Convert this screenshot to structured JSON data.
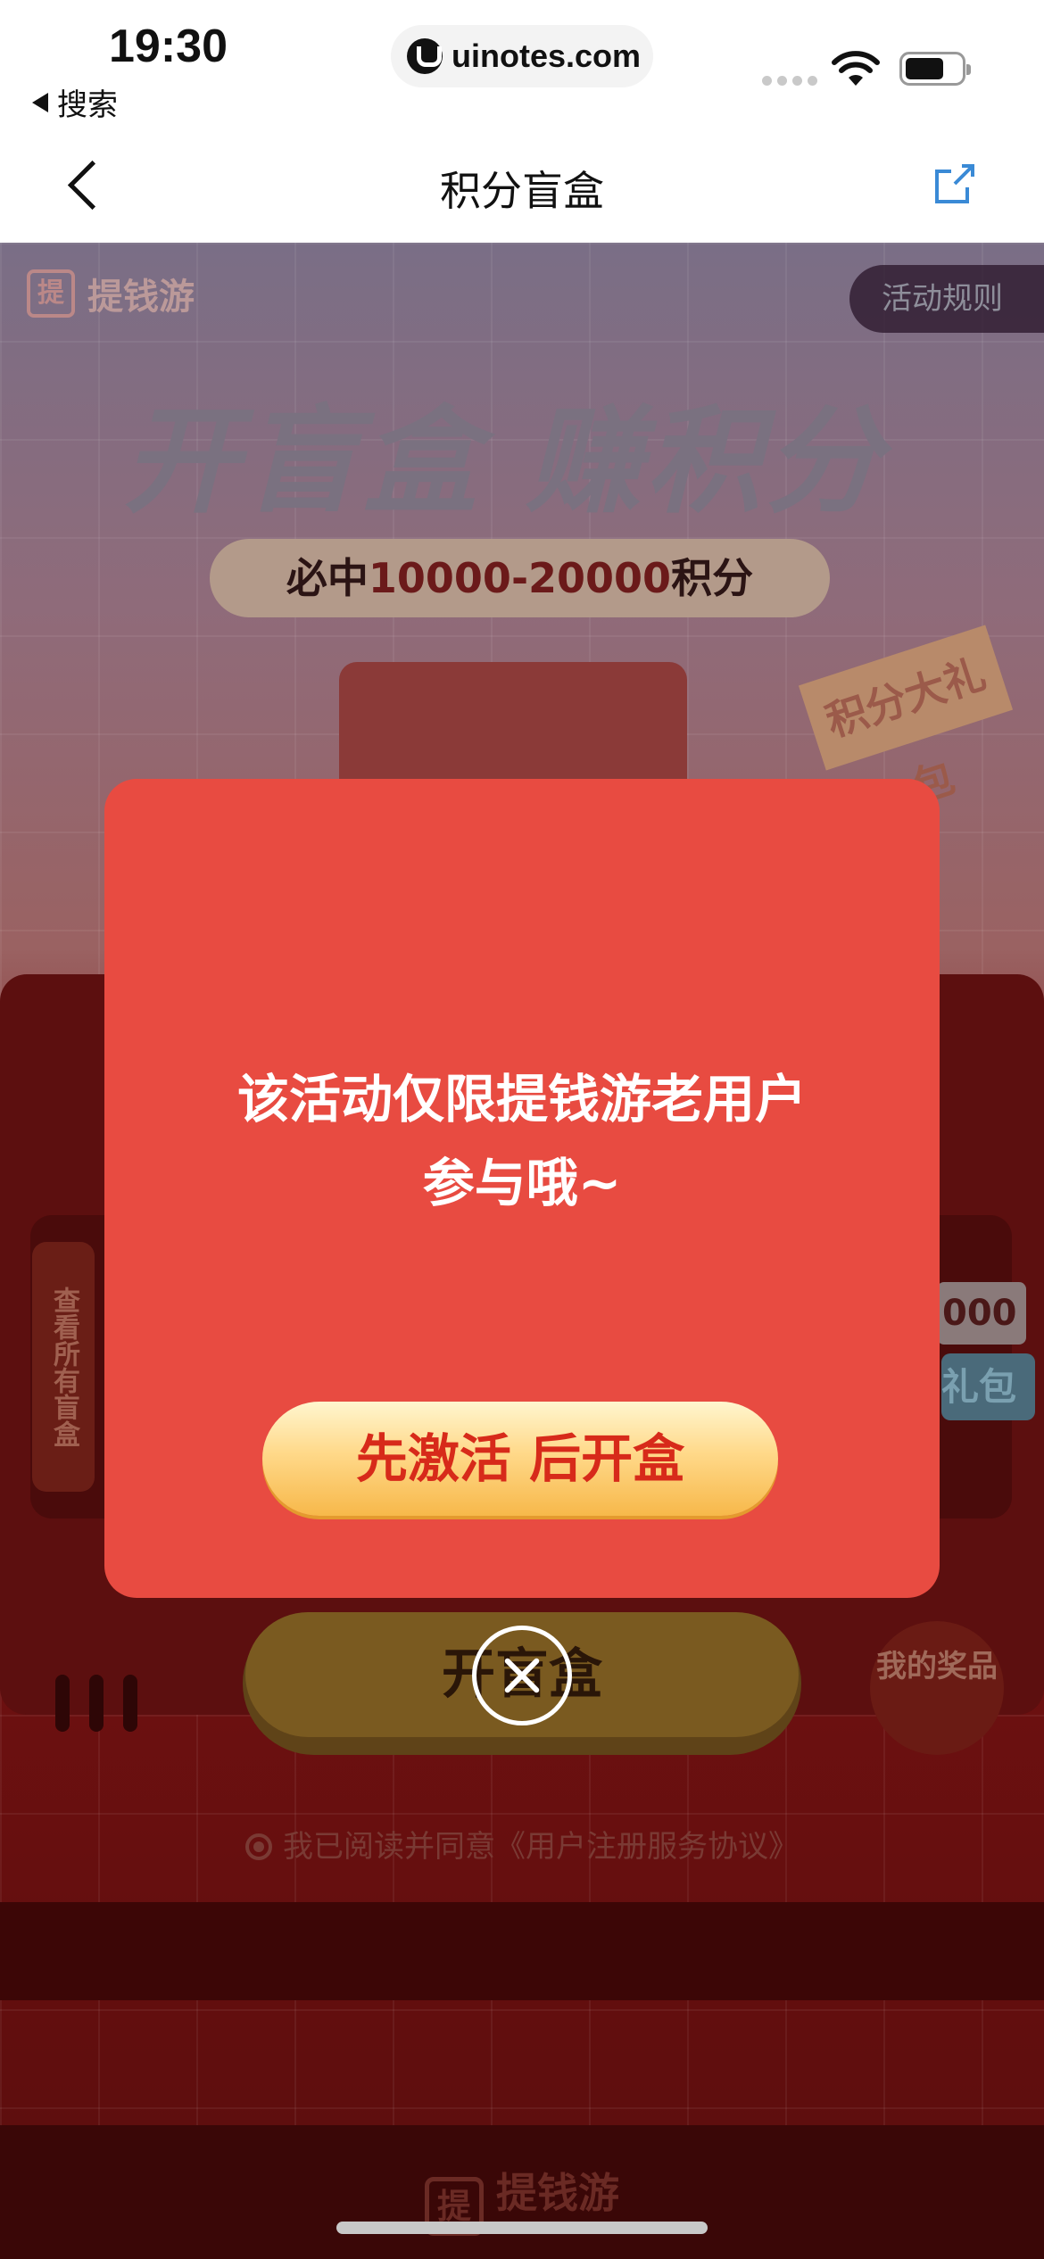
{
  "status_bar": {
    "time": "19:30",
    "back_app": "搜索",
    "url": "uinotes.com"
  },
  "nav": {
    "title": "积分盲盒"
  },
  "page": {
    "brand": "提钱游",
    "brand_icon_char": "提",
    "rules_button": "活动规则",
    "headline": "开盲盒  赚积分",
    "subline_prefix": "必中",
    "subline_range": "10000-20000",
    "subline_suffix": "积分",
    "gift_tag": "积分大礼包",
    "see_all_boxes": "查看所有盲盒",
    "right_partial_number": "000",
    "right_partial_label": "礼包",
    "open_button": "开盲盒",
    "my_prizes": "我的奖品",
    "agreement": "我已阅读并同意《用户注册服务协议》"
  },
  "dialog": {
    "message_line1": "该活动仅限提钱游老用户",
    "message_line2": "参与哦~",
    "action_button": "先激活 后开盒"
  },
  "colors": {
    "dialog_bg": "#e84b41",
    "action_text": "#d72a1a",
    "action_gradient_top": "#fff6cf",
    "action_gradient_bottom": "#f7b84a"
  }
}
